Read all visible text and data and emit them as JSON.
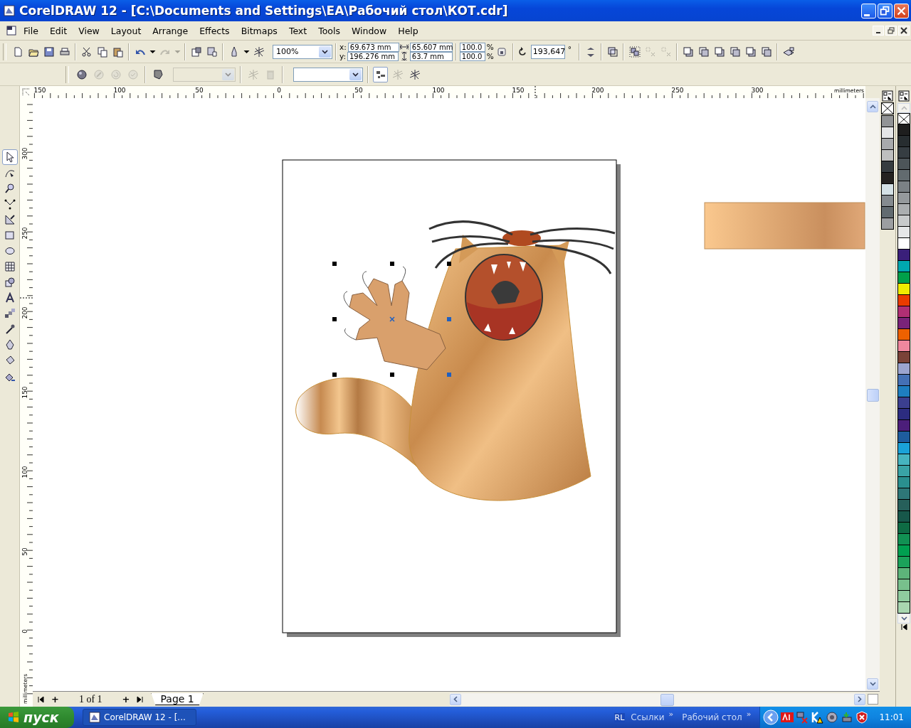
{
  "window": {
    "title": "CorelDRAW 12 - [C:\\Documents and Settings\\EA\\Рабочий стол\\КОТ.cdr]"
  },
  "menu": [
    "File",
    "Edit",
    "View",
    "Layout",
    "Arrange",
    "Effects",
    "Bitmaps",
    "Text",
    "Tools",
    "Window",
    "Help"
  ],
  "standard_toolbar": {
    "buttons": [
      {
        "disabled": false
      },
      {
        "disabled": false
      },
      {
        "disabled": false
      },
      {
        "disabled": false
      },
      {
        "disabled": false
      },
      {
        "disabled": false
      },
      {
        "disabled": false
      },
      {
        "disabled": false
      },
      {
        "disabled": false
      },
      {
        "disabled": true
      },
      {
        "disabled": true
      },
      {
        "disabled": false
      },
      {
        "disabled": false
      },
      {
        "disabled": false
      },
      {
        "disabled": false
      },
      {
        "disabled": false
      }
    ],
    "zoom": "100%"
  },
  "property_bar": {
    "position": [
      {
        "label": "x:",
        "value": "69.673 mm"
      },
      {
        "label": "y:",
        "value": "196.276 mm"
      }
    ],
    "size": [
      {
        "value": "65.607 mm"
      },
      {
        "value": "63.7 mm"
      }
    ],
    "scale": [
      {
        "value": "100.0",
        "unit": "%"
      },
      {
        "value": "100.0",
        "unit": "%"
      }
    ],
    "rotation": {
      "value": "193,647",
      "unit": "°"
    },
    "buttons": [
      {
        "disabled": false
      },
      {
        "disabled": false
      },
      {
        "disabled": false
      },
      {
        "disabled": true
      },
      {
        "disabled": true
      },
      {
        "disabled": false
      },
      {
        "disabled": false
      },
      {
        "disabled": false
      },
      {
        "disabled": false
      },
      {
        "disabled": false
      },
      {
        "disabled": false
      },
      {
        "disabled": false
      }
    ]
  },
  "second_toolbar": {
    "buttons": [
      {
        "disabled": false,
        "pressed": false
      },
      {
        "disabled": true,
        "pressed": false
      },
      {
        "disabled": true,
        "pressed": false
      },
      {
        "disabled": true,
        "pressed": false
      },
      {
        "disabled": false,
        "pressed": false
      },
      {
        "disabled": true,
        "pressed": false
      },
      {
        "disabled": true,
        "pressed": false
      },
      {
        "disabled": false,
        "pressed": true
      },
      {
        "disabled": true,
        "pressed": false
      },
      {
        "disabled": false,
        "pressed": false
      }
    ],
    "combos": [
      {
        "disabled": true
      },
      {
        "disabled": false
      }
    ]
  },
  "toolbox": [
    {
      "selected": true
    },
    {
      "selected": false
    },
    {
      "selected": false
    },
    {
      "selected": false
    },
    {
      "selected": false
    },
    {
      "selected": false
    },
    {
      "selected": false
    },
    {
      "selected": false
    },
    {
      "selected": false
    },
    {
      "selected": false
    },
    {
      "selected": false
    },
    {
      "selected": false
    },
    {
      "selected": false
    },
    {
      "selected": false
    },
    {
      "selected": false
    }
  ],
  "top_ruler": {
    "labels": [
      "150",
      "100",
      "50",
      "0",
      "50",
      "100",
      "150",
      "200",
      "250",
      "300"
    ],
    "unit": "millimeters"
  },
  "left_ruler": {
    "labels": [
      "300",
      "250",
      "200",
      "150",
      "100",
      "50",
      "0"
    ],
    "unit": "millimeters"
  },
  "page_navigator": {
    "add_before": "+",
    "count": "1 of 1",
    "add_after": "+",
    "tab": "Page 1"
  },
  "document_palette": [
    {
      "color": "#929496"
    },
    {
      "color": "#e5e6e7"
    },
    {
      "color": "#a8aaac"
    },
    {
      "color": "#bebfbf"
    },
    {
      "color": "#363c40"
    },
    {
      "color": "#242220"
    },
    {
      "color": "#d4e1e5"
    },
    {
      "color": "#858b8f"
    },
    {
      "color": "#626b70"
    },
    {
      "color": "#9c9ea1"
    }
  ],
  "color_palette": [
    {
      "color": "#1e1e1e"
    },
    {
      "color": "#272d30"
    },
    {
      "color": "#363d42"
    },
    {
      "color": "#4d5559"
    },
    {
      "color": "#626b6f"
    },
    {
      "color": "#7b8185"
    },
    {
      "color": "#95999c"
    },
    {
      "color": "#abaeb0"
    },
    {
      "color": "#c8cacb"
    },
    {
      "color": "#e6e7e8"
    },
    {
      "color": "#ffffff"
    },
    {
      "color": "#3a1f7a"
    },
    {
      "color": "#00a7b0"
    },
    {
      "color": "#00a04a"
    },
    {
      "color": "#f0ec00"
    },
    {
      "color": "#ea3b00"
    },
    {
      "color": "#b02f74"
    },
    {
      "color": "#7a2379"
    },
    {
      "color": "#ee6100"
    },
    {
      "color": "#ef879e"
    },
    {
      "color": "#7a4238"
    },
    {
      "color": "#9ba4cf"
    },
    {
      "color": "#4470b5"
    },
    {
      "color": "#1e7ec0"
    },
    {
      "color": "#3b3f8f"
    },
    {
      "color": "#2c2c80"
    },
    {
      "color": "#4c1e7a"
    },
    {
      "color": "#1e5c9e"
    },
    {
      "color": "#1aa2d8"
    },
    {
      "color": "#46b4c0"
    },
    {
      "color": "#39a3a6"
    },
    {
      "color": "#2a8f8f"
    },
    {
      "color": "#2e7777"
    },
    {
      "color": "#265f5a"
    },
    {
      "color": "#17574a"
    },
    {
      "color": "#0e6b44"
    },
    {
      "color": "#119153"
    },
    {
      "color": "#00a050"
    },
    {
      "color": "#1ba25a"
    },
    {
      "color": "#5db47a"
    },
    {
      "color": "#78c08c"
    },
    {
      "color": "#8fcc9e"
    },
    {
      "color": "#a8d6b0"
    }
  ],
  "taskbar": {
    "start": "пуск",
    "tasks": [
      {
        "label": "CorelDRAW 12 - [..."
      }
    ],
    "language": "RL",
    "toolbars": [
      {
        "label": "Ссылки",
        "more": "»"
      },
      {
        "label": "Рабочий стол",
        "more": "»"
      }
    ],
    "clock": "11:01"
  }
}
